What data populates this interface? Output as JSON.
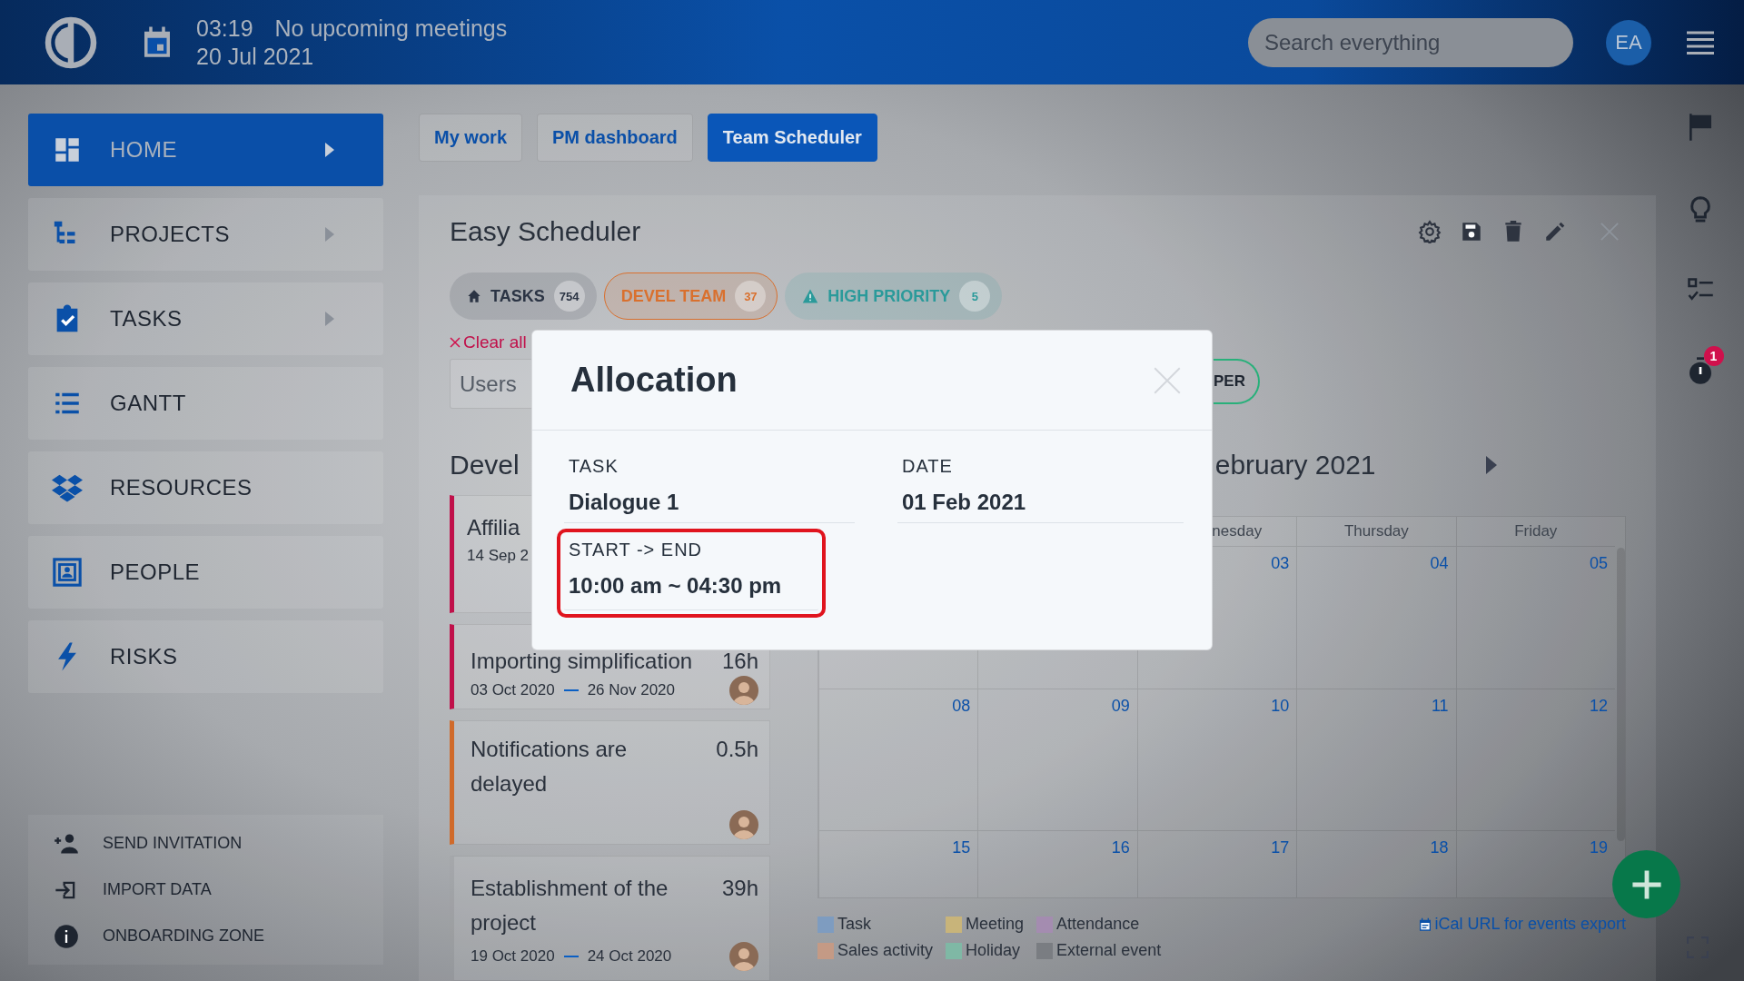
{
  "header": {
    "time": "03:19",
    "meetings": "No upcoming meetings",
    "date": "20 Jul 2021",
    "search": {
      "placeholder": "Search everything"
    },
    "user_initials": "EA"
  },
  "sidebar": {
    "items": [
      {
        "label": "HOME",
        "selected": true,
        "submenu": true
      },
      {
        "label": "PROJECTS",
        "selected": false,
        "submenu": true
      },
      {
        "label": "TASKS",
        "selected": false,
        "submenu": true
      },
      {
        "label": "GANTT",
        "selected": false,
        "submenu": false
      },
      {
        "label": "RESOURCES",
        "selected": false,
        "submenu": false
      },
      {
        "label": "PEOPLE",
        "selected": false,
        "submenu": false
      },
      {
        "label": "RISKS",
        "selected": false,
        "submenu": false
      }
    ],
    "bottom_items": [
      "SEND INVITATION",
      "IMPORT DATA",
      "ONBOARDING ZONE"
    ]
  },
  "tabs": [
    {
      "label": "My work",
      "selected": false
    },
    {
      "label": "PM dashboard",
      "selected": false
    },
    {
      "label": "Team Scheduler",
      "selected": true
    }
  ],
  "scheduler": {
    "title": "Easy Scheduler",
    "filters": [
      {
        "label": "TASKS",
        "count": "754",
        "color": "#2b3444",
        "selected": false
      },
      {
        "label": "DEVEL TEAM",
        "count": "37",
        "color": "#d9702e",
        "selected": true
      },
      {
        "label": "HIGH PRIORITY",
        "count": "5",
        "color": "#2a9a9a",
        "selected": false
      }
    ],
    "clear": "Clear all",
    "users_field": {
      "placeholder": "Users"
    },
    "partial_button": "PER",
    "list_heading": "Devel",
    "month_heading": "ebruary 2021",
    "tasks": [
      {
        "title": "Affilia",
        "dates": "14 Sep 2",
        "color": "#c0104a"
      },
      {
        "title": "Importing simplification",
        "hours": "16h",
        "start": "03 Oct 2020",
        "end": "26 Nov 2020",
        "color": "#c0104a"
      },
      {
        "title": "Notifications are delayed",
        "hours": "0.5h",
        "color": "#d06a2a"
      },
      {
        "title": "Establishment of the project",
        "hours": "39h",
        "start": "19 Oct 2020",
        "end": "24 Oct 2020"
      }
    ],
    "calendar": {
      "weekdays": [
        "nesday",
        "Thursday",
        "Friday"
      ],
      "weeks": [
        [
          "03",
          "04",
          "05"
        ],
        [
          "08",
          "09",
          "10",
          "11",
          "12"
        ],
        [
          "15",
          "16",
          "17",
          "18",
          "19"
        ]
      ]
    },
    "legend": [
      {
        "label": "Task",
        "color": "#7e9cc0"
      },
      {
        "label": "Meeting",
        "color": "#c8b47a"
      },
      {
        "label": "Attendance",
        "color": "#a48cb0"
      },
      {
        "label": "Sales activity",
        "color": "#c49a85"
      },
      {
        "label": "Holiday",
        "color": "#7fb8a5"
      },
      {
        "label": "External event",
        "color": "#7a7d82"
      }
    ],
    "ical_link": "iCal URL for events export"
  },
  "rail": {
    "timer_badge": "1"
  },
  "modal": {
    "title": "Allocation",
    "fields": [
      {
        "label": "TASK",
        "value": "Dialogue 1",
        "highlighted": false
      },
      {
        "label": "DATE",
        "value": "01 Feb 2021",
        "highlighted": false
      },
      {
        "label": "START -> END",
        "value": "10:00 am ~ 04:30 pm",
        "highlighted": true
      }
    ]
  }
}
